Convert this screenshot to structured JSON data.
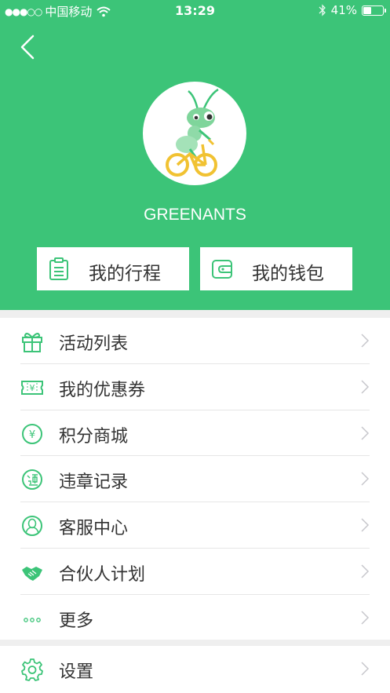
{
  "status_bar": {
    "signal": "●●●○○",
    "carrier": "中国移动",
    "time": "13:29",
    "battery": "41%",
    "battery_level": 0.41
  },
  "profile": {
    "username": "GREENANTS"
  },
  "quick_actions": {
    "trips_label": "我的行程",
    "wallet_label": "我的钱包"
  },
  "menu": {
    "items": [
      {
        "label": "活动列表",
        "icon": "gift-icon"
      },
      {
        "label": "我的优惠券",
        "icon": "coupon-icon"
      },
      {
        "label": "积分商城",
        "icon": "yuan-icon"
      },
      {
        "label": "违章记录",
        "icon": "violation-icon"
      },
      {
        "label": "客服中心",
        "icon": "support-icon"
      },
      {
        "label": "合伙人计划",
        "icon": "handshake-icon"
      },
      {
        "label": "更多",
        "icon": "more-icon"
      }
    ],
    "settings_label": "设置"
  },
  "colors": {
    "brand": "#3cc478",
    "icon": "#3cc478"
  }
}
